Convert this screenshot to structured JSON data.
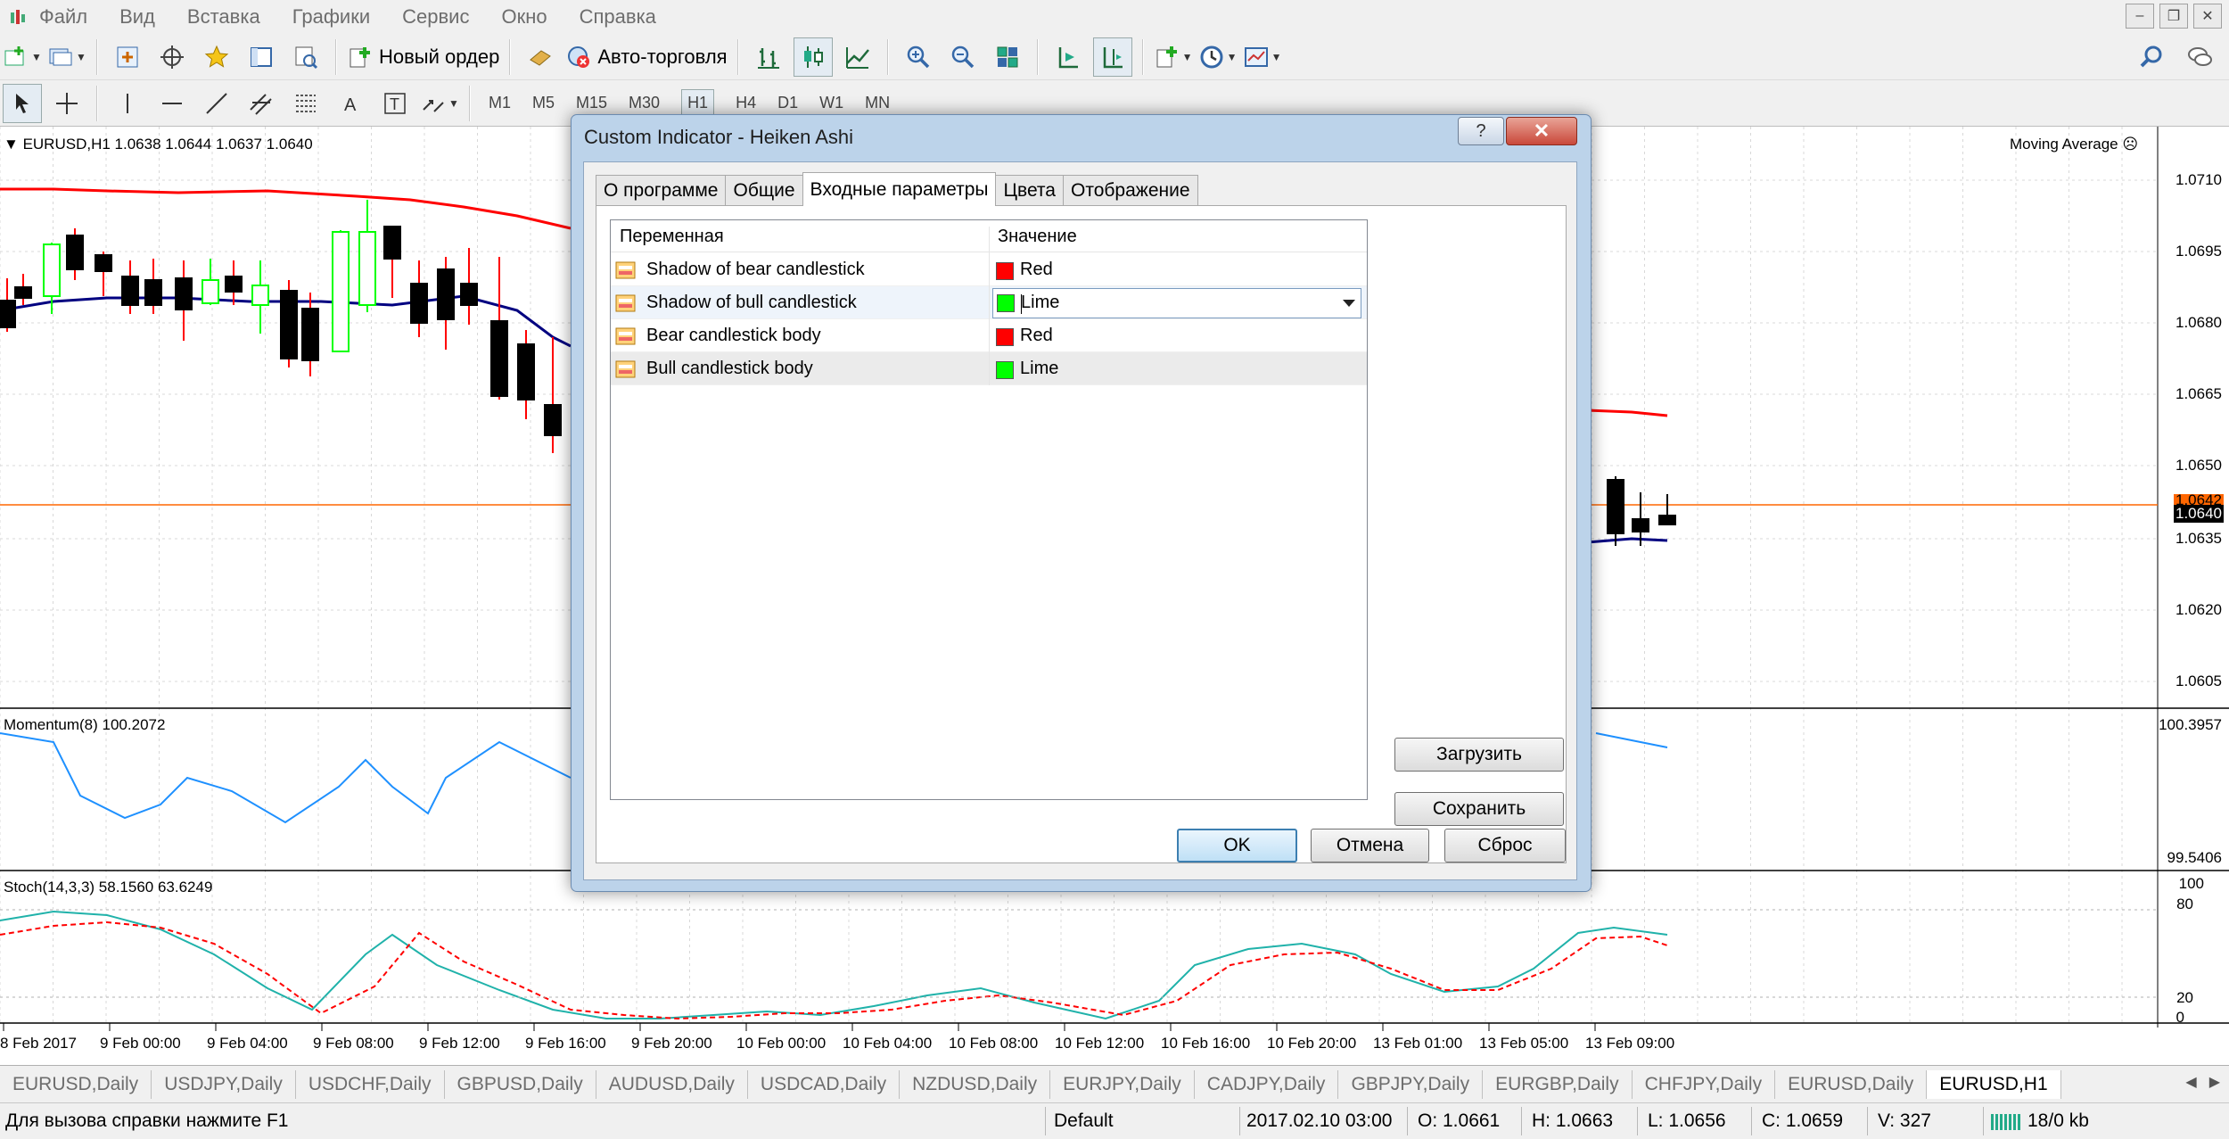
{
  "menu": {
    "items": [
      "Файл",
      "Вид",
      "Вставка",
      "Графики",
      "Сервис",
      "Окно",
      "Справка"
    ]
  },
  "toolbar": {
    "new_order_label": "Новый ордер",
    "autotrading_label": "Авто-торговля",
    "timeframes": [
      "M1",
      "M5",
      "M15",
      "M30",
      "H1",
      "H4",
      "D1",
      "W1",
      "MN"
    ],
    "active_timeframe": "H1"
  },
  "chart": {
    "symbol_info": "EURUSD,H1  1.0638 1.0644 1.0637 1.0640",
    "indicator_label": "Moving Average",
    "price_axis": [
      "1.0710",
      "1.0695",
      "1.0680",
      "1.0665",
      "1.0650",
      "1.0635",
      "1.0620",
      "1.0605"
    ],
    "price_marker_upper": "1.0642",
    "price_marker": "1.0640",
    "momentum_label": "Momentum(8) 100.2072",
    "momentum_axis_top": "100.3957",
    "momentum_axis_bottom": "99.5406",
    "stoch_label": "Stoch(14,3,3) 58.1560 63.6249",
    "stoch_axis": [
      "100",
      "80",
      "20",
      "0"
    ],
    "time_axis": [
      "8 Feb 2017",
      "9 Feb 00:00",
      "9 Feb 04:00",
      "9 Feb 08:00",
      "9 Feb 12:00",
      "9 Feb 16:00",
      "9 Feb 20:00",
      "10 Feb 00:00",
      "10 Feb 04:00",
      "10 Feb 08:00",
      "10 Feb 12:00",
      "10 Feb 16:00",
      "10 Feb 20:00",
      "13 Feb 01:00",
      "13 Feb 05:00",
      "13 Feb 09:00"
    ],
    "colors": {
      "bear": "#000000",
      "bull": "#00ff00",
      "ma_red": "#ff0000",
      "ma_navy": "#000080",
      "momentum": "#1e90ff",
      "stoch_main": "#20b2aa",
      "stoch_signal": "#ff0000",
      "price_line": "#ff6600"
    }
  },
  "symbol_tabs": [
    "EURUSD,Daily",
    "USDJPY,Daily",
    "USDCHF,Daily",
    "GBPUSD,Daily",
    "AUDUSD,Daily",
    "USDCAD,Daily",
    "NZDUSD,Daily",
    "EURJPY,Daily",
    "CADJPY,Daily",
    "GBPJPY,Daily",
    "EURGBP,Daily",
    "CHFJPY,Daily",
    "EURUSD,Daily",
    "EURUSD,H1"
  ],
  "status": {
    "help": "Для вызова справки нажмите F1",
    "profile": "Default",
    "datetime": "2017.02.10 03:00",
    "open": "O: 1.0661",
    "high": "H: 1.0663",
    "low": "L: 1.0656",
    "close": "C: 1.0659",
    "volume": "V: 327",
    "traffic": "18/0 kb"
  },
  "dialog": {
    "title": "Custom Indicator - Heiken Ashi",
    "help_glyph": "?",
    "close_glyph": "✕",
    "tabs": [
      "О программе",
      "Общие",
      "Входные параметры",
      "Цвета",
      "Отображение"
    ],
    "active_tab": "Входные параметры",
    "grid": {
      "col_variable": "Переменная",
      "col_value": "Значение",
      "rows": [
        {
          "name": "Shadow of bear candlestick",
          "value": "Red",
          "color": "#ff0000"
        },
        {
          "name": "Shadow of bull candlestick",
          "value": "Lime",
          "color": "#00ff00"
        },
        {
          "name": "Bear candlestick body",
          "value": "Red",
          "color": "#ff0000"
        },
        {
          "name": "Bull candlestick body",
          "value": "Lime",
          "color": "#00ff00"
        }
      ]
    },
    "load_label": "Загрузить",
    "save_label": "Сохранить",
    "ok_label": "OK",
    "cancel_label": "Отмена",
    "reset_label": "Сброс"
  }
}
